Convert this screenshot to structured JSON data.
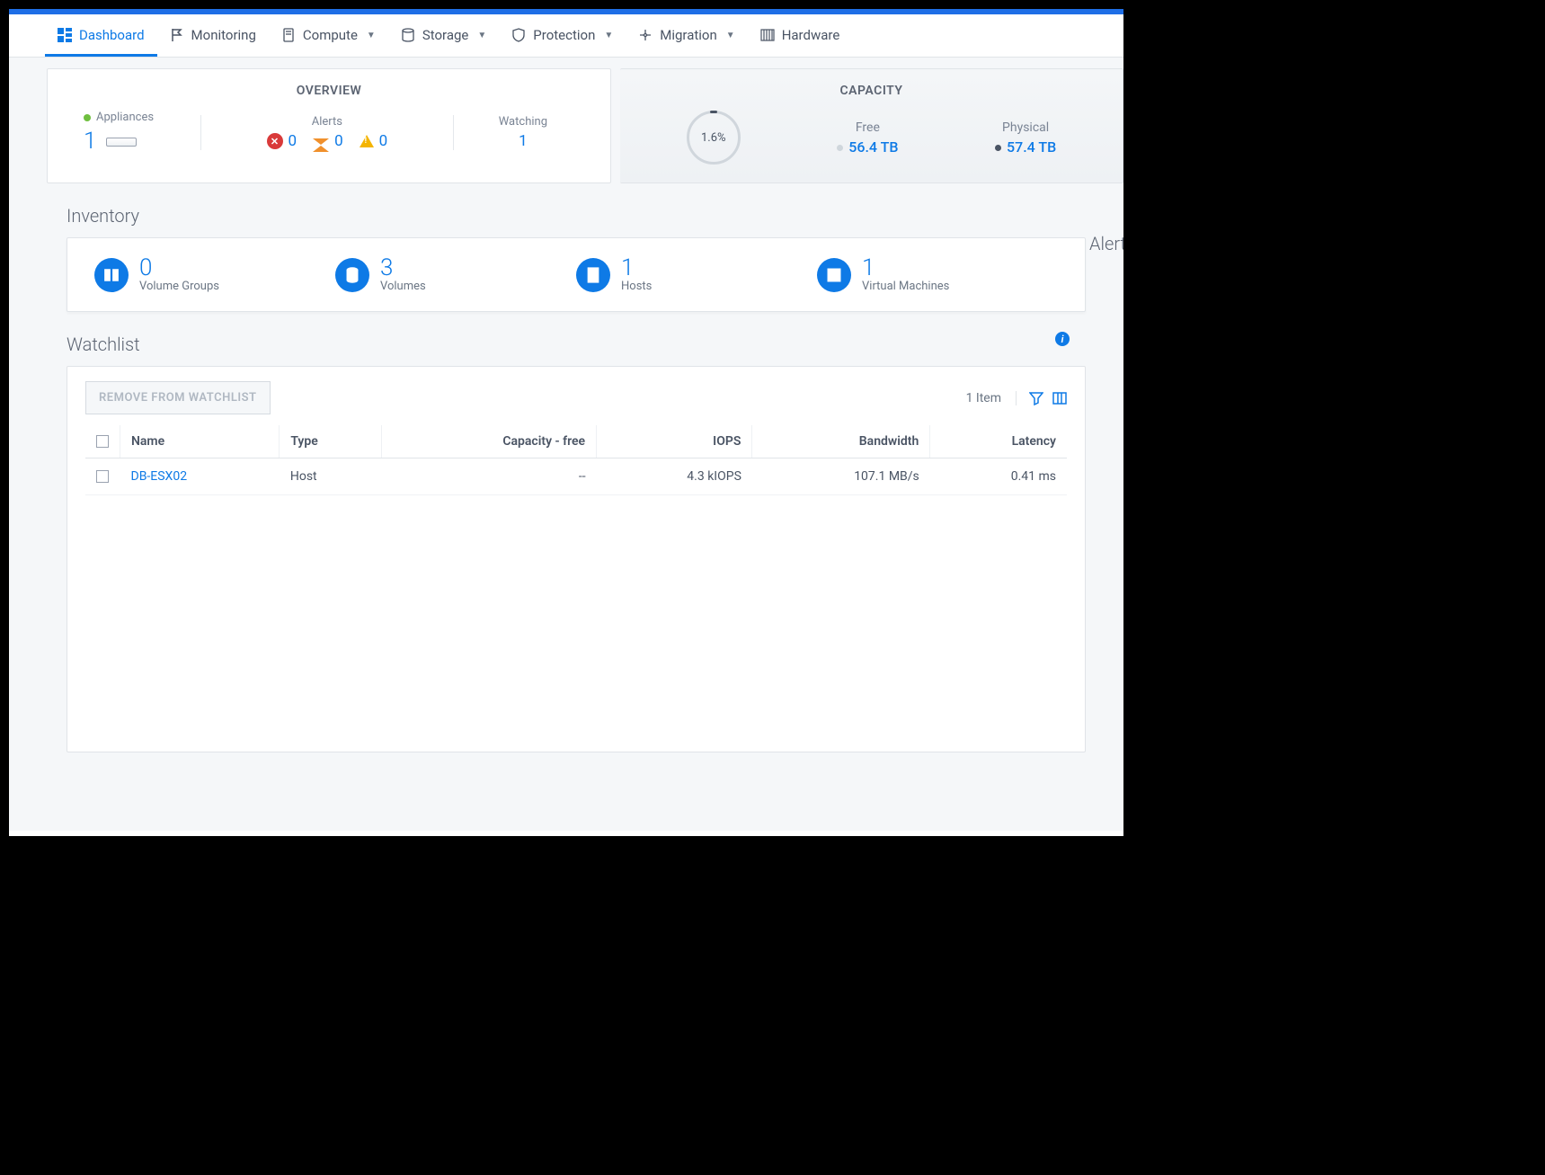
{
  "nav": {
    "items": [
      {
        "label": "Dashboard"
      },
      {
        "label": "Monitoring"
      },
      {
        "label": "Compute"
      },
      {
        "label": "Storage"
      },
      {
        "label": "Protection"
      },
      {
        "label": "Migration"
      },
      {
        "label": "Hardware"
      }
    ]
  },
  "overview": {
    "title": "OVERVIEW",
    "appliances": {
      "label": "Appliances",
      "count": "1"
    },
    "alerts": {
      "label": "Alerts",
      "error": "0",
      "warningMajor": "0",
      "warningMinor": "0"
    },
    "watching": {
      "label": "Watching",
      "count": "1"
    }
  },
  "capacity": {
    "title": "CAPACITY",
    "usedPct": "1.6%",
    "free": {
      "label": "Free",
      "value": "56.4 TB"
    },
    "physical": {
      "label": "Physical",
      "value": "57.4 TB"
    }
  },
  "inventory": {
    "title": "Inventory",
    "items": [
      {
        "count": "0",
        "label": "Volume Groups"
      },
      {
        "count": "3",
        "label": "Volumes"
      },
      {
        "count": "1",
        "label": "Hosts"
      },
      {
        "count": "1",
        "label": "Virtual Machines"
      }
    ]
  },
  "sideAlerts": {
    "title": "Alerts"
  },
  "watchlist": {
    "title": "Watchlist",
    "removeBtn": "REMOVE FROM WATCHLIST",
    "itemCount": "1 Item",
    "columns": {
      "name": "Name",
      "type": "Type",
      "capacity": "Capacity - free",
      "iops": "IOPS",
      "bandwidth": "Bandwidth",
      "latency": "Latency"
    },
    "rows": [
      {
        "name": "DB-ESX02",
        "type": "Host",
        "capacity": "--",
        "iops": "4.3 kIOPS",
        "bandwidth": "107.1 MB/s",
        "latency": "0.41 ms"
      }
    ]
  }
}
